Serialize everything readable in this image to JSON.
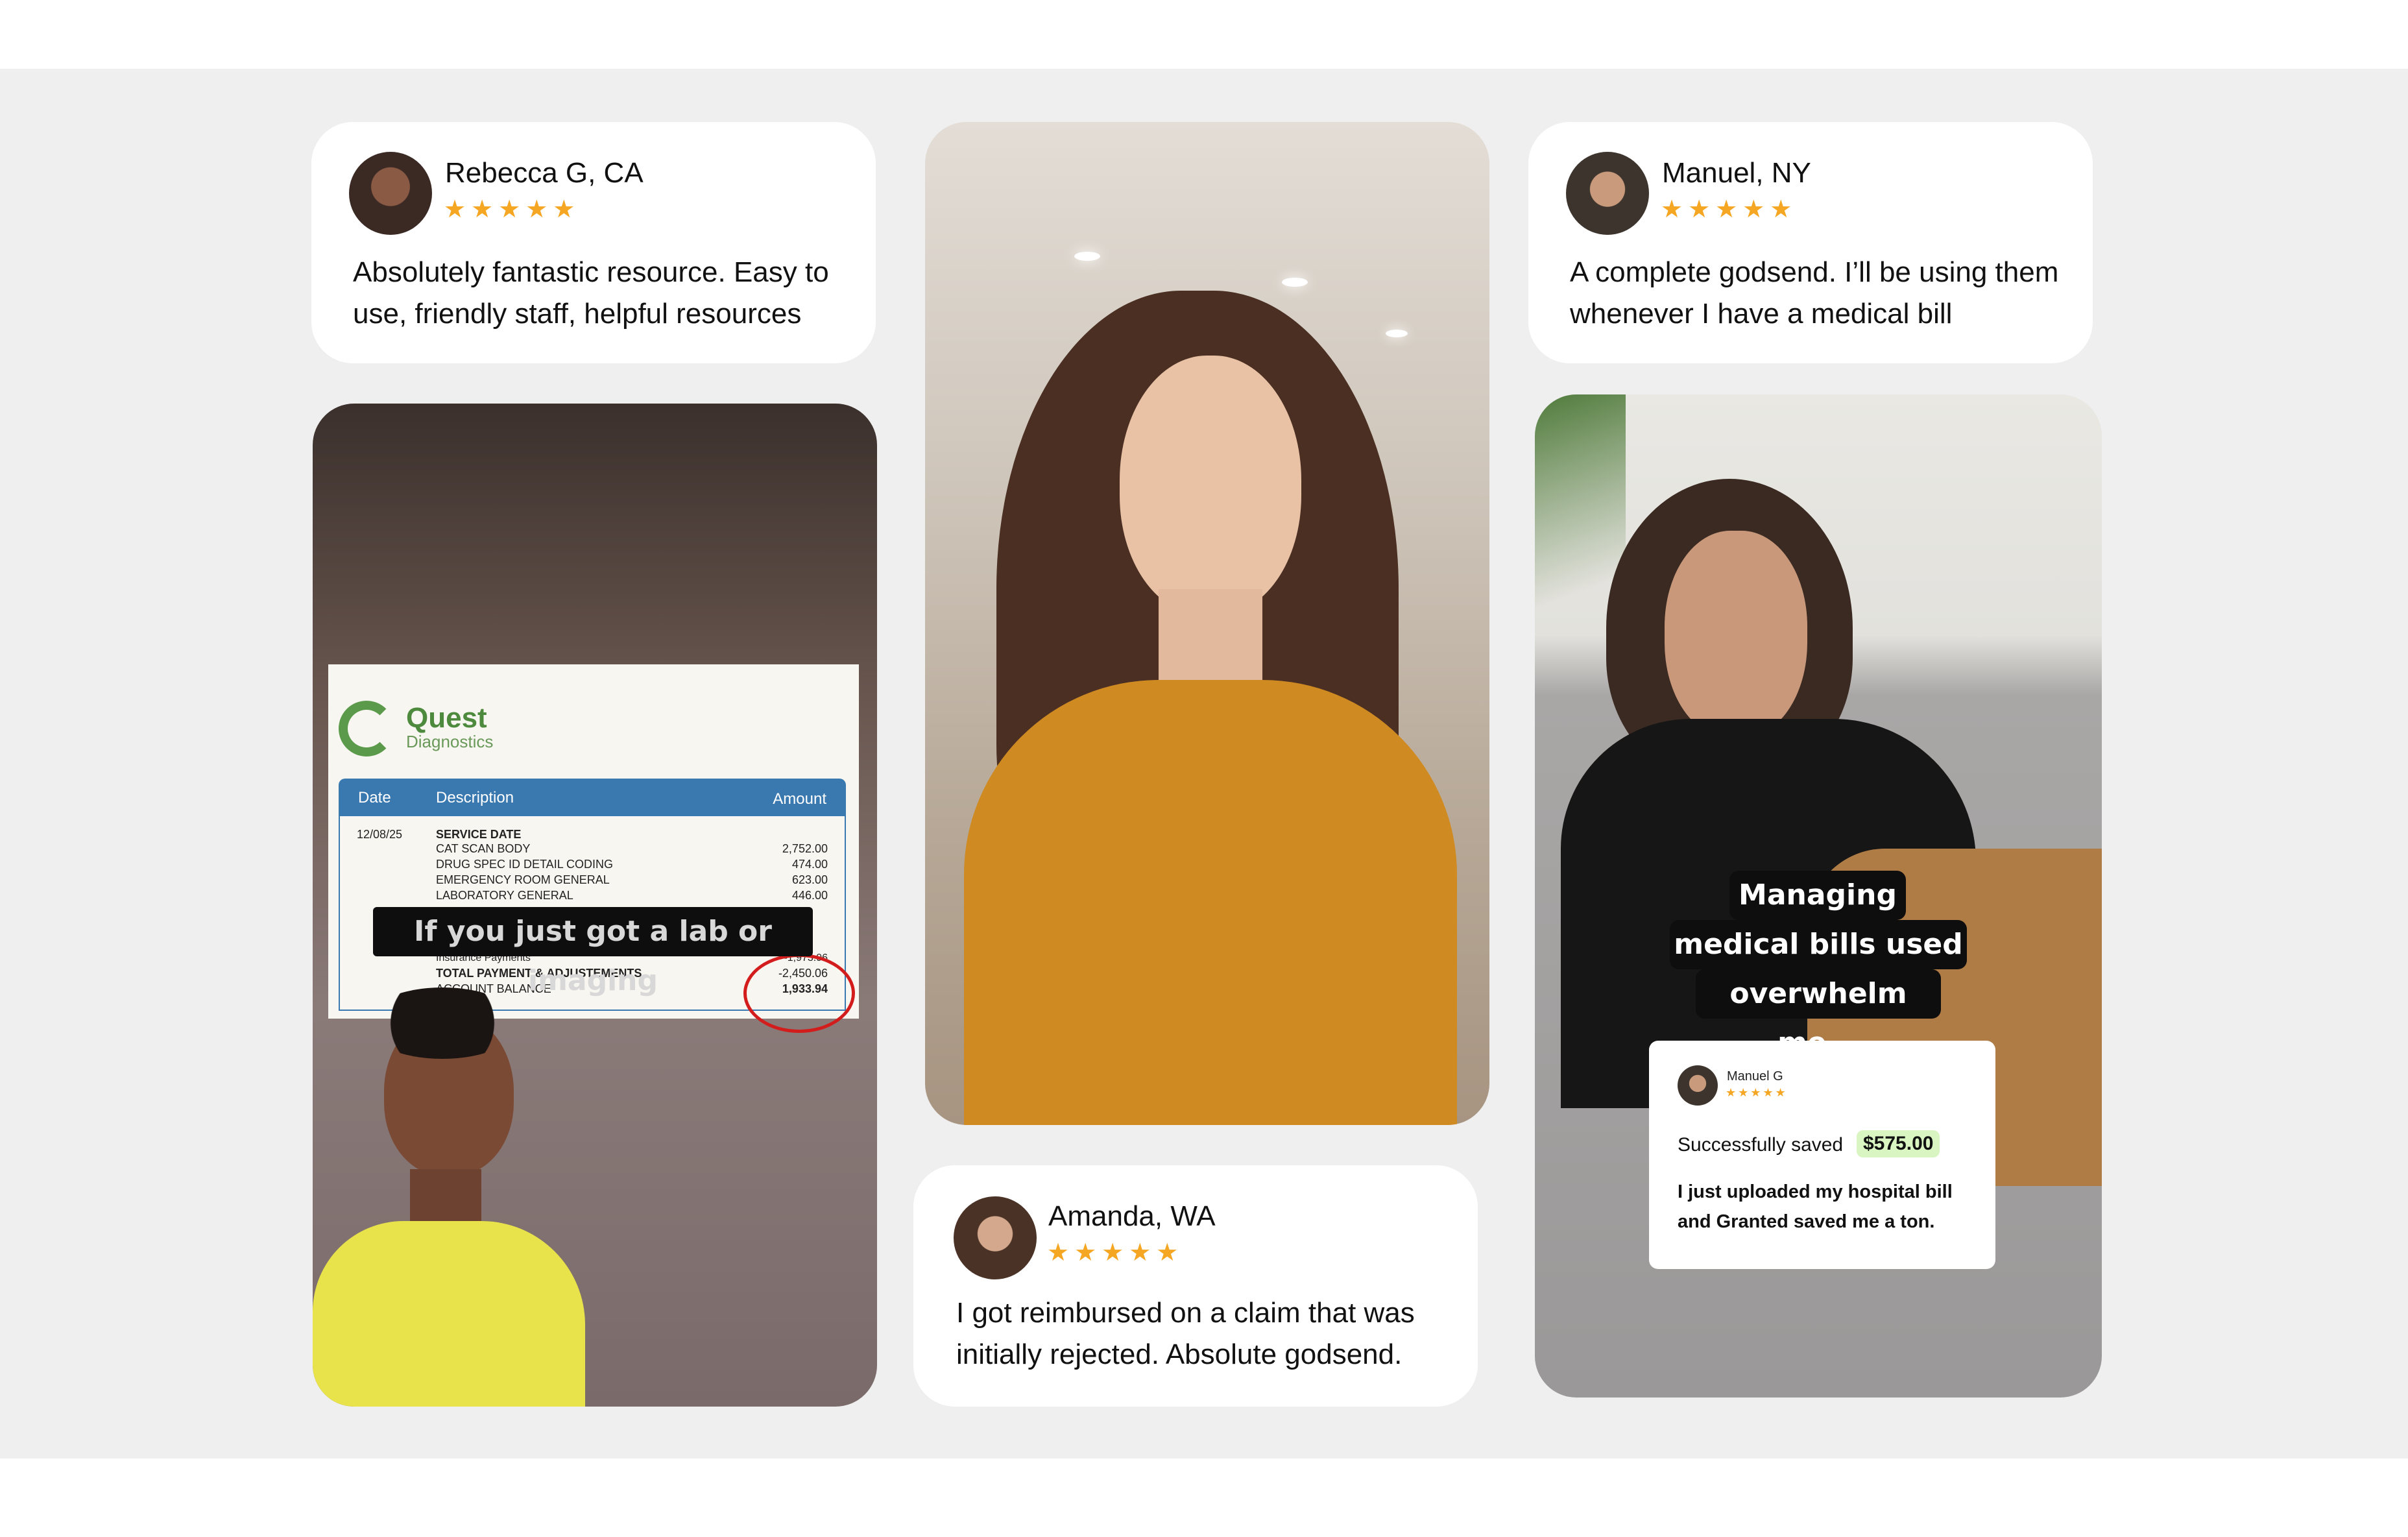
{
  "reviews": {
    "rebecca": {
      "name": "Rebecca G, CA",
      "stars": "★★★★★",
      "text": "Absolutely fantastic resource. Easy to use, friendly staff, helpful resources"
    },
    "manuel": {
      "name": "Manuel, NY",
      "stars": "★★★★★",
      "text": "A complete godsend. I’ll be using them whenever I have a medical bill"
    },
    "amanda": {
      "name": "Amanda, WA",
      "stars": "★★★★★",
      "text": "I got reimbursed on a claim that was initially rejected. Absolute godsend."
    }
  },
  "video1": {
    "caption": "If you just got a lab or imaging",
    "bill": {
      "brand": "Quest",
      "brand_sub": "Diagnostics",
      "headers": {
        "date": "Date",
        "description": "Description",
        "amount": "Amount"
      },
      "date": "12/08/25",
      "service_label": "SERVICE DATE",
      "lines": [
        {
          "desc": "CAT SCAN BODY",
          "amount": "2,752.00"
        },
        {
          "desc": "DRUG SPEC ID DETAIL CODING",
          "amount": "474.00"
        },
        {
          "desc": "EMERGENCY ROOM GENERAL",
          "amount": "623.00"
        },
        {
          "desc": "LABORATORY GENERAL",
          "amount": "446.00"
        }
      ],
      "insurance_label": "Insurance Payments",
      "insurance_amount": "-1,973.96",
      "total_label": "TOTAL PAYMENT & ADJUSTEMENTS",
      "total_amount": "-2,450.06",
      "balance_label": "ACCOUNT BALANCE",
      "balance_amount": "1,933.94"
    }
  },
  "video3": {
    "caption_lines": [
      "Managing",
      "medical bills used to",
      "overwhelm me..."
    ],
    "mini_review": {
      "name": "Manuel G",
      "stars": "★★★★★",
      "saved_label": "Successfully saved",
      "saved_amount": "$575.00",
      "text": "I just uploaded my hospital bill and Granted saved me a ton."
    }
  },
  "colors": {
    "star": "#f5a623",
    "saved_highlight": "#d9f5c2",
    "band": "#efefef",
    "caption_bg": "#0e0e0e"
  }
}
